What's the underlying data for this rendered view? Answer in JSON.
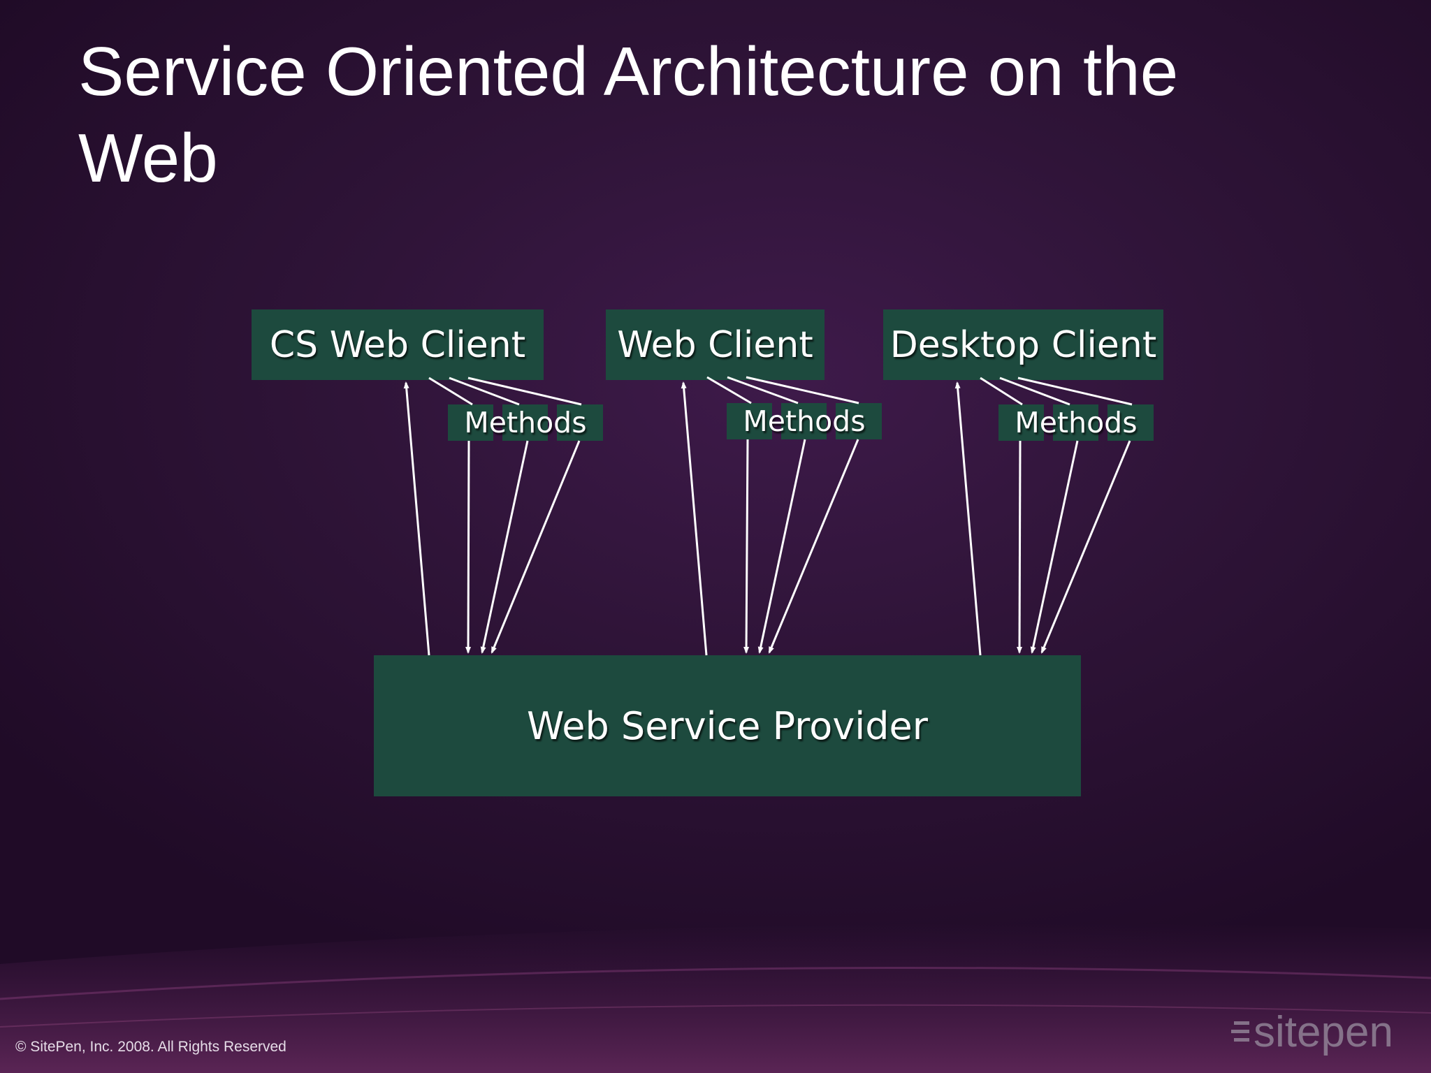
{
  "slide": {
    "title": "Service Oriented Architecture on the Web"
  },
  "clients": [
    {
      "label": "CS Web Client",
      "methods_label": "Methods"
    },
    {
      "label": "Web Client",
      "methods_label": "Methods"
    },
    {
      "label": "Desktop Client",
      "methods_label": "Methods"
    }
  ],
  "provider": {
    "label": "Web Service Provider"
  },
  "footer": {
    "copyright": "© SitePen, Inc. 2008. All Rights Reserved"
  },
  "logo": {
    "text": "sitepen"
  },
  "colors": {
    "box_fill": "#1d4a3e",
    "background": "#2f1438",
    "text": "#ffffff"
  }
}
